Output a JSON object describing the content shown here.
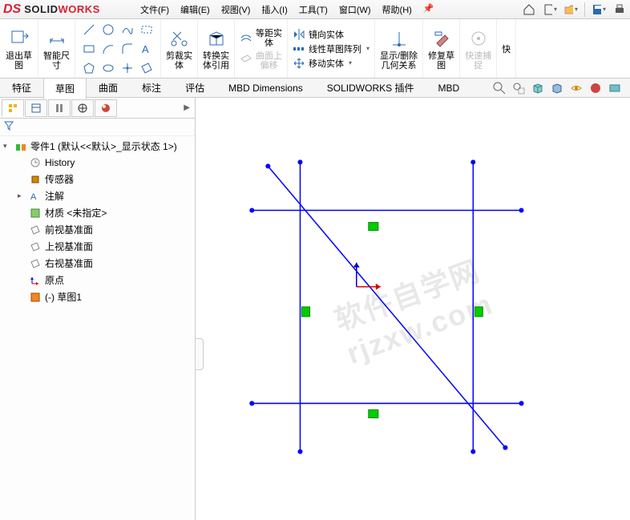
{
  "app": {
    "logo_solid": "SOLID",
    "logo_works": "WORKS"
  },
  "menu": {
    "file": "文件(F)",
    "edit": "编辑(E)",
    "view": "视图(V)",
    "insert": "插入(I)",
    "tools": "工具(T)",
    "window": "窗口(W)",
    "help": "帮助(H)"
  },
  "ribbon": {
    "exit_sketch": "退出草\n图",
    "smart_dim": "智能尺\n寸",
    "trim": "剪裁实\n体",
    "convert": "转换实\n体引用",
    "offset": "等距实\n体",
    "offset_surface": "曲面上\n偏移",
    "mirror": "镜向实体",
    "linear_pattern": "线性草图阵列",
    "move": "移动实体",
    "show_relations": "显示/删除\n几何关系",
    "repair": "修复草\n图",
    "quick_snap": "快速捕\n捉",
    "quick": "快"
  },
  "cmd_tabs": {
    "feature": "特征",
    "sketch": "草图",
    "surface": "曲面",
    "annotate": "标注",
    "evaluate": "评估",
    "mbd_dim": "MBD Dimensions",
    "sw_addin": "SOLIDWORKS 插件",
    "mbd": "MBD"
  },
  "tree": {
    "root": "零件1 (默认<<默认>_显示状态 1>)",
    "history": "History",
    "sensors": "传感器",
    "annotations": "注解",
    "material": "材质 <未指定>",
    "front_plane": "前视基准面",
    "top_plane": "上视基准面",
    "right_plane": "右视基准面",
    "origin": "原点",
    "sketch1": "(-) 草图1"
  },
  "watermark": "软件自学网\nrjzxw.com"
}
